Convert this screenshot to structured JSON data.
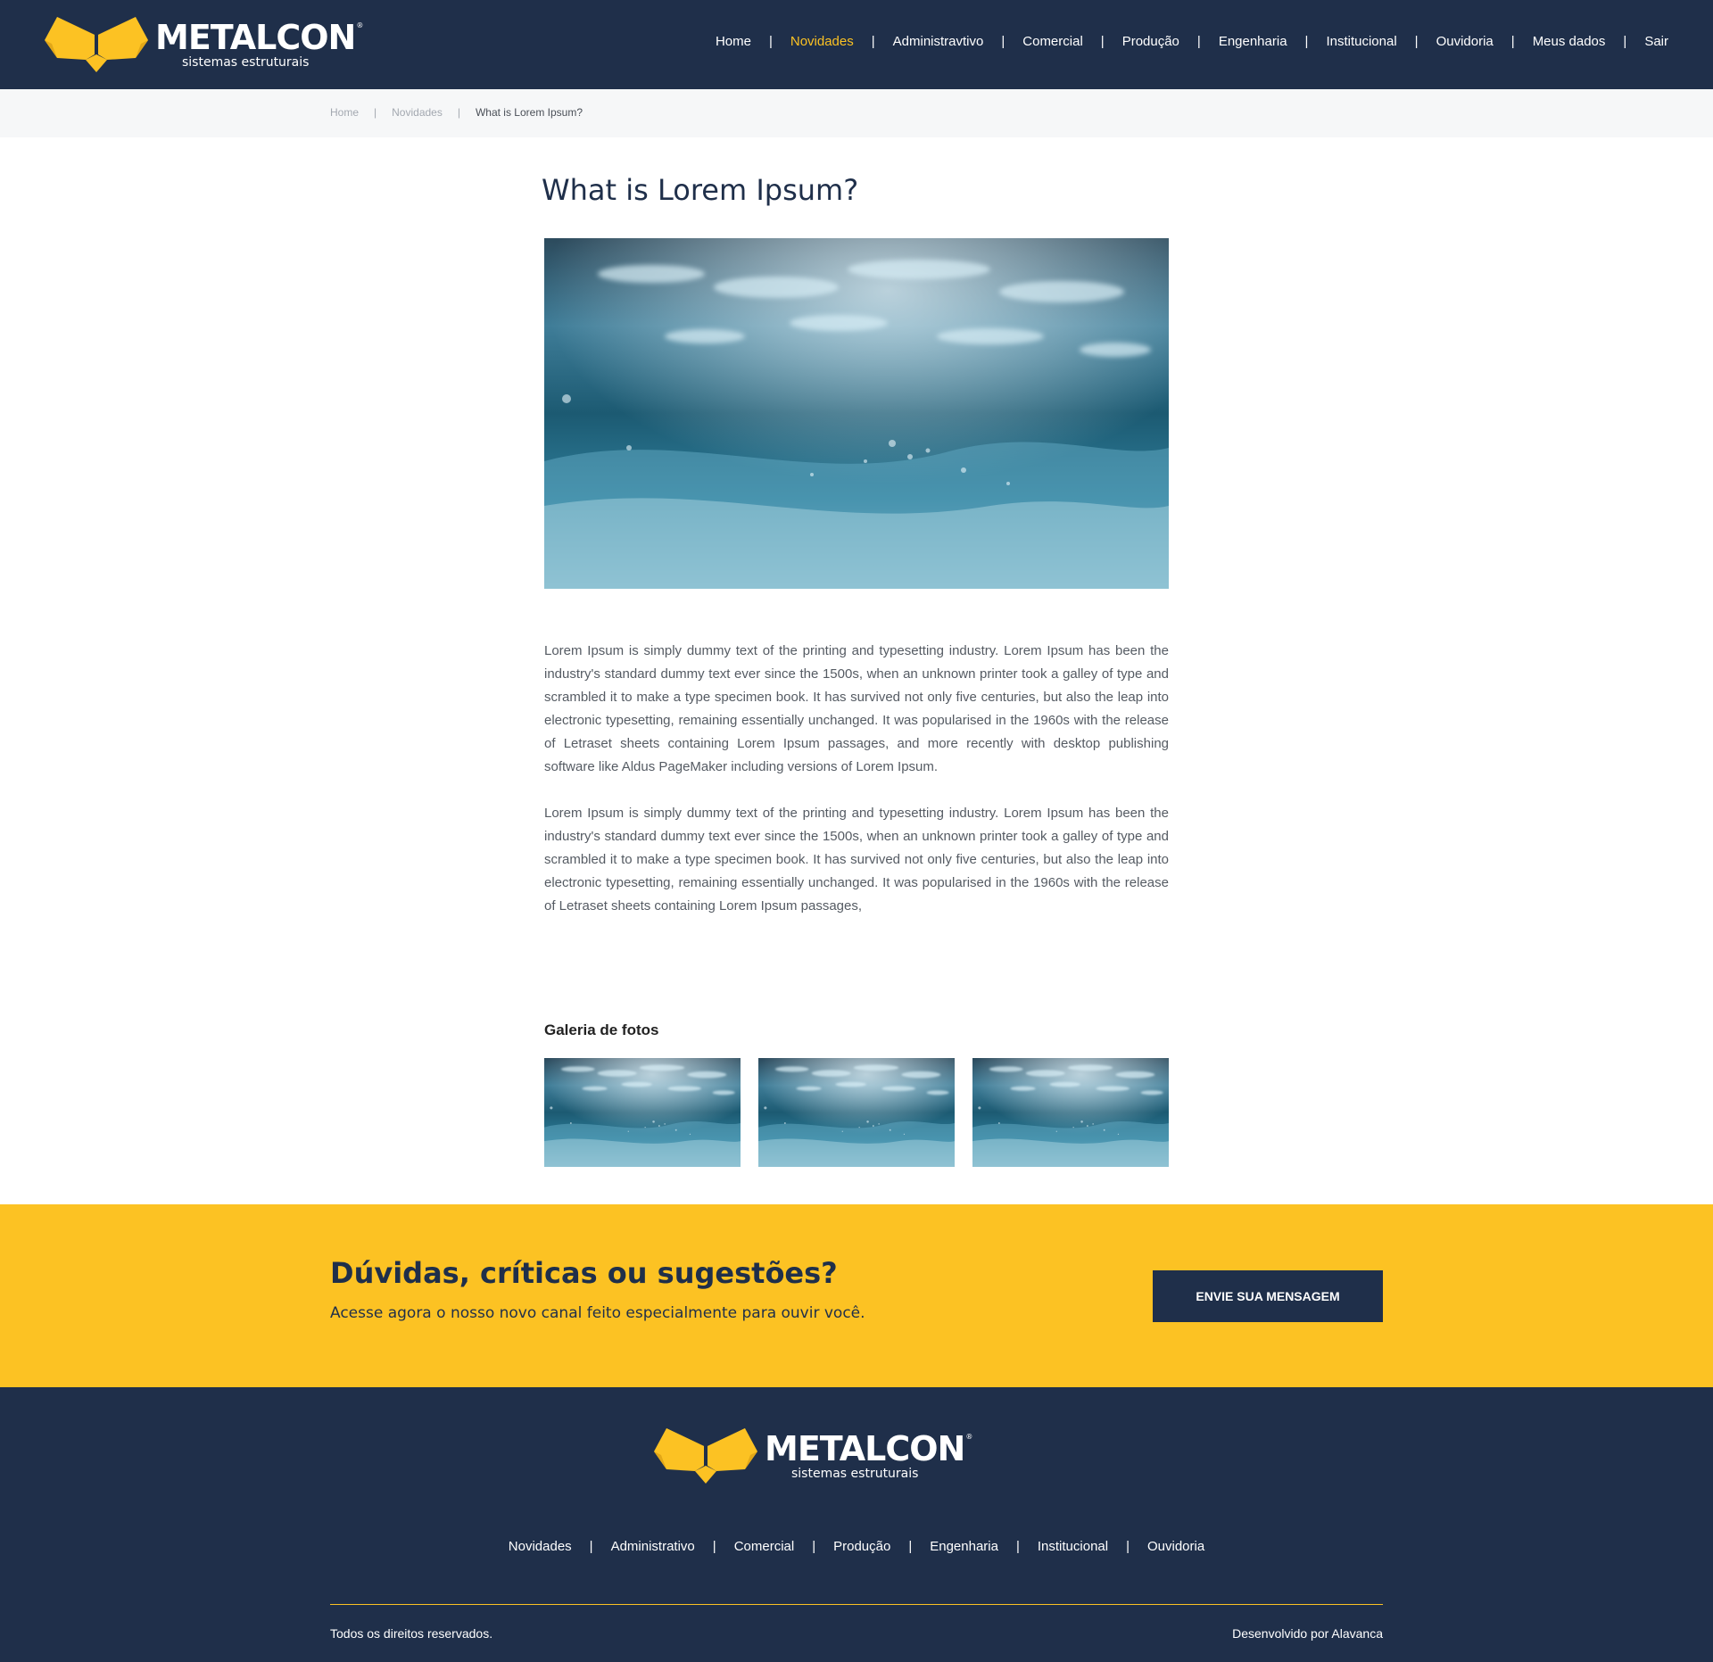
{
  "brand": {
    "name": "METALCON",
    "registered_mark": "®",
    "tagline": "sistemas estruturais",
    "logo_icon": "metalcon-m-logo-icon",
    "colors": {
      "navy": "#1f2f4a",
      "yellow": "#fcc223",
      "yellow_dark": "#e2a717",
      "white": "#ffffff"
    }
  },
  "header": {
    "nav": [
      {
        "label": "Home",
        "active": false
      },
      {
        "label": "Novidades",
        "active": true
      },
      {
        "label": "Administravtivo",
        "active": false
      },
      {
        "label": "Comercial",
        "active": false
      },
      {
        "label": "Produção",
        "active": false
      },
      {
        "label": "Engenharia",
        "active": false
      },
      {
        "label": "Institucional",
        "active": false
      },
      {
        "label": "Ouvidoria",
        "active": false
      },
      {
        "label": "Meus dados",
        "active": false
      },
      {
        "label": "Sair",
        "active": false
      }
    ],
    "separator": "|"
  },
  "breadcrumb": {
    "items": [
      "Home",
      "Novidades",
      "What is Lorem Ipsum?"
    ],
    "separator": "|"
  },
  "article": {
    "title": "What is Lorem Ipsum?",
    "paragraphs": [
      "Lorem Ipsum is simply dummy text of the printing and typesetting industry. Lorem Ipsum has been the industry's standard dummy text ever since the 1500s, when an unknown printer took a galley of type and scrambled it to make a type specimen book. It has survived not only five centuries, but also the leap into electronic typesetting, remaining essentially unchanged. It was popularised in the 1960s with the release of Letraset sheets containing Lorem Ipsum passages, and more recently with desktop publishing software like Aldus PageMaker including versions of Lorem Ipsum.",
      "Lorem Ipsum is simply dummy text of the printing and typesetting industry. Lorem Ipsum has been the industry's standard dummy text ever since the 1500s, when an unknown printer took a galley of type and scrambled it to make a type specimen book. It has survived not only five centuries, but also the leap into electronic typesetting, remaining essentially unchanged. It was popularised in the 1960s with the release of Letraset sheets containing Lorem Ipsum passages,"
    ]
  },
  "gallery": {
    "title": "Galeria de fotos",
    "thumbnail_count": 3
  },
  "cta": {
    "title": "Dúvidas, críticas ou sugestões?",
    "subtitle": "Acesse agora o nosso novo canal feito especialmente para ouvir você.",
    "button_label": "ENVIE SUA MENSAGEM"
  },
  "footer": {
    "nav": [
      "Novidades",
      "Administrativo",
      "Comercial",
      "Produção",
      "Engenharia",
      "Institucional",
      "Ouvidoria"
    ],
    "separator": "|",
    "rights": "Todos os direitos reservados.",
    "developer": "Desenvolvido por Alavanca"
  }
}
